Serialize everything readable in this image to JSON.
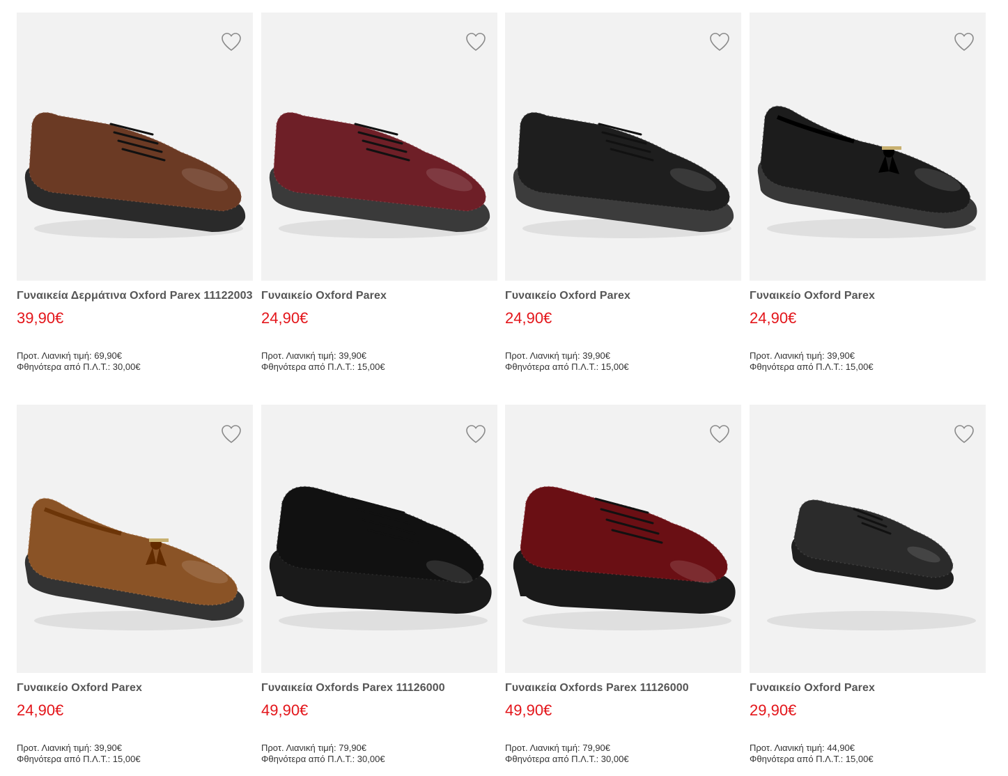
{
  "colors": {
    "price": "#e3151a",
    "image_bg": "#f2f2f2",
    "title": "#555555"
  },
  "products": [
    {
      "title": "Γυναικεία Δερμάτινα Oxford Parex 11122003",
      "price": "39,90€",
      "retail": "Προτ. Λιανική τιμή: 69,90€",
      "savings": "Φθηνότερα από Π.Λ.Τ.: 30,00€",
      "shoe_color": "#6b3a24",
      "sole_color": "#2a2a2a",
      "style": "lace"
    },
    {
      "title": "Γυναικείο Oxford Parex",
      "price": "24,90€",
      "retail": "Προτ. Λιανική τιμή: 39,90€",
      "savings": "Φθηνότερα από Π.Λ.Τ.: 15,00€",
      "shoe_color": "#6e1f27",
      "sole_color": "#3a3a3a",
      "style": "lace"
    },
    {
      "title": "Γυναικείο Oxford Parex",
      "price": "24,90€",
      "retail": "Προτ. Λιανική τιμή: 39,90€",
      "savings": "Φθηνότερα από Π.Λ.Τ.: 15,00€",
      "shoe_color": "#1e1e1e",
      "sole_color": "#3c3c3c",
      "style": "lace"
    },
    {
      "title": "Γυναικείο Oxford Parex",
      "price": "24,90€",
      "retail": "Προτ. Λιανική τιμή: 39,90€",
      "savings": "Φθηνότερα από Π.Λ.Τ.: 15,00€",
      "shoe_color": "#1c1c1c",
      "sole_color": "#383838",
      "style": "loafer"
    },
    {
      "title": "Γυναικείο Oxford Parex",
      "price": "24,90€",
      "retail": "Προτ. Λιανική τιμή: 39,90€",
      "savings": "Φθηνότερα από Π.Λ.Τ.: 15,00€",
      "shoe_color": "#8a5326",
      "sole_color": "#333333",
      "style": "loafer"
    },
    {
      "title": "Γυναικεία Oxfords Parex 11126000",
      "price": "49,90€",
      "retail": "Προτ. Λιανική τιμή: 79,90€",
      "savings": "Φθηνότερα από Π.Λ.Τ.: 30,00€",
      "shoe_color": "#111111",
      "sole_color": "#1a1a1a",
      "style": "chunky"
    },
    {
      "title": "Γυναικεία Oxfords Parex 11126000",
      "price": "49,90€",
      "retail": "Προτ. Λιανική τιμή: 79,90€",
      "savings": "Φθηνότερα από Π.Λ.Τ.: 30,00€",
      "shoe_color": "#6a0f14",
      "sole_color": "#1a1a1a",
      "style": "chunky"
    },
    {
      "title": "Γυναικείο Oxford Parex",
      "price": "29,90€",
      "retail": "Προτ. Λιανική τιμή: 44,90€",
      "savings": "Φθηνότερα από Π.Λ.Τ.: 15,00€",
      "shoe_color": "#2b2b2b",
      "sole_color": "#1f1f1f",
      "style": "small"
    }
  ]
}
